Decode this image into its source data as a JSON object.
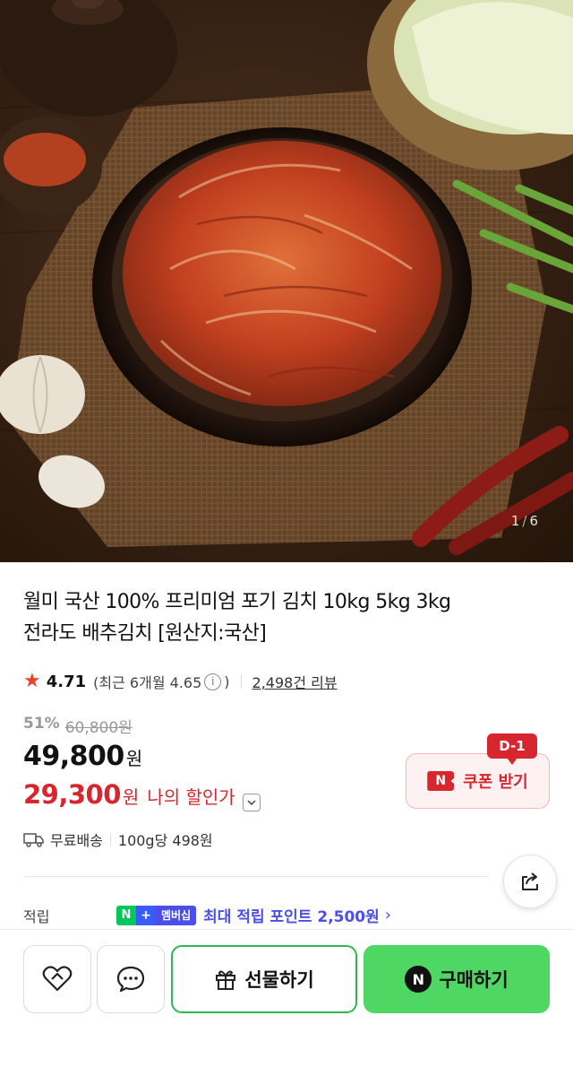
{
  "hero": {
    "image_alt": "김치 상품 이미지",
    "counter_current": "1",
    "counter_separator": "/",
    "counter_total": "6"
  },
  "product": {
    "title_line1": "월미 국산 100% 프리미엄 포기 김치 10kg 5kg 3kg",
    "title_line2": "전라도 배추김치 [원산지:국산]",
    "rating": "4.71",
    "recent_prefix": "(최근 6개월 4.65",
    "recent_suffix": ")",
    "info_icon": "i",
    "reviews": "2,498건 리뷰",
    "discount_rate": "51%",
    "original_price": "60,800원",
    "sale_price": "49,800",
    "currency": "원",
    "my_price": "29,300",
    "my_price_label": "나의 할인가",
    "shipping": "무료배송",
    "unit_price": "100g당 498원"
  },
  "coupon": {
    "dday": "D-1",
    "n_mark": "N",
    "label": "쿠폰 받기"
  },
  "points": {
    "label": "적립",
    "badge_n": "N",
    "badge_plus": "+",
    "badge_text": "멤버십",
    "text": "최대 적립 포인트 2,500원",
    "chevron": "›"
  },
  "actions": {
    "gift_label": "선물하기",
    "buy_n": "N",
    "buy_label": "구매하기"
  },
  "colors": {
    "accent_red": "#d8262e",
    "naver_green": "#4fd764",
    "membership_blue": "#4b4ee8",
    "star": "#e8432d"
  },
  "icons": [
    "star-icon",
    "info-icon",
    "chevron-down-icon",
    "truck-icon",
    "share-icon",
    "wishlist-icon",
    "chat-icon",
    "gift-icon",
    "naver-pay-icon"
  ]
}
